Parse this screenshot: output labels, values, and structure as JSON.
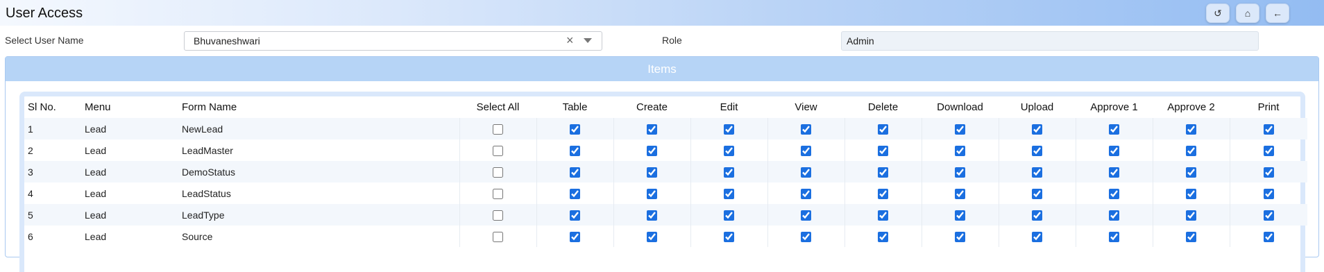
{
  "header": {
    "title": "User Access",
    "buttons": [
      {
        "name": "refresh-button",
        "icon": "history-icon",
        "glyph": "↺"
      },
      {
        "name": "home-button",
        "icon": "home-icon",
        "glyph": "⌂"
      },
      {
        "name": "back-button",
        "icon": "arrow-left-icon",
        "glyph": "←"
      }
    ]
  },
  "form": {
    "user_label": "Select User Name",
    "user_value": "Bhuvaneshwari",
    "role_label": "Role",
    "role_value": "Admin"
  },
  "panel": {
    "title": "Items"
  },
  "table": {
    "columns": [
      "Sl No.",
      "Menu",
      "Form Name",
      "Select All",
      "Table",
      "Create",
      "Edit",
      "View",
      "Delete",
      "Download",
      "Upload",
      "Approve 1",
      "Approve 2",
      "Print"
    ],
    "rows": [
      {
        "sl": "1",
        "menu": "Lead",
        "form": "NewLead",
        "select_all": false,
        "perms": [
          true,
          true,
          true,
          true,
          true,
          true,
          true,
          true,
          true,
          true
        ]
      },
      {
        "sl": "2",
        "menu": "Lead",
        "form": "LeadMaster",
        "select_all": false,
        "perms": [
          true,
          true,
          true,
          true,
          true,
          true,
          true,
          true,
          true,
          true
        ]
      },
      {
        "sl": "3",
        "menu": "Lead",
        "form": "DemoStatus",
        "select_all": false,
        "perms": [
          true,
          true,
          true,
          true,
          true,
          true,
          true,
          true,
          true,
          true
        ]
      },
      {
        "sl": "4",
        "menu": "Lead",
        "form": "LeadStatus",
        "select_all": false,
        "perms": [
          true,
          true,
          true,
          true,
          true,
          true,
          true,
          true,
          true,
          true
        ]
      },
      {
        "sl": "5",
        "menu": "Lead",
        "form": "LeadType",
        "select_all": false,
        "perms": [
          true,
          true,
          true,
          true,
          true,
          true,
          true,
          true,
          true,
          true
        ]
      },
      {
        "sl": "6",
        "menu": "Lead",
        "form": "Source",
        "select_all": false,
        "perms": [
          true,
          true,
          true,
          true,
          true,
          true,
          true,
          true,
          true,
          true
        ]
      }
    ]
  },
  "colors": {
    "accent": "#1b6fe0",
    "header_gradient_end": "#93bcf2",
    "panel_header": "#b6d4f6"
  }
}
